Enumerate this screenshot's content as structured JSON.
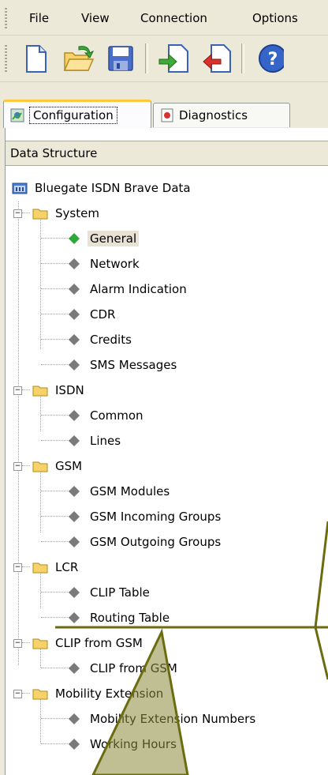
{
  "menu": {
    "items": [
      {
        "label": "File"
      },
      {
        "label": "View"
      },
      {
        "label": "Connection"
      },
      {
        "label": "Options"
      }
    ]
  },
  "toolbar": {
    "buttons": [
      "new-document-icon",
      "open-folder-icon",
      "save-icon",
      "import-icon",
      "export-icon",
      "help-icon"
    ]
  },
  "tabs": [
    {
      "label": "Configuration",
      "active": true
    },
    {
      "label": "Diagnostics",
      "active": false
    }
  ],
  "panel": {
    "header": "Data Structure"
  },
  "tree": {
    "root": "Bluegate ISDN Brave Data",
    "groups": [
      {
        "label": "System",
        "items": [
          "General",
          "Network",
          "Alarm Indication",
          "CDR",
          "Credits",
          "SMS Messages"
        ]
      },
      {
        "label": "ISDN",
        "items": [
          "Common",
          "Lines"
        ]
      },
      {
        "label": "GSM",
        "items": [
          "GSM Modules",
          "GSM Incoming Groups",
          "GSM Outgoing Groups"
        ]
      },
      {
        "label": "LCR",
        "items": [
          "CLIP Table",
          "Routing Table"
        ]
      },
      {
        "label": "CLIP from GSM",
        "items": [
          "CLIP from GSM"
        ]
      },
      {
        "label": "Mobility Extension",
        "items": [
          "Mobility Extension Numbers",
          "Working Hours"
        ]
      }
    ],
    "selected": "General"
  },
  "colors": {
    "background": "#ECE9D8",
    "selected_diamond": "#2FA83A",
    "diamond": "#7A7A7A",
    "overlay": "#6B6B10"
  }
}
